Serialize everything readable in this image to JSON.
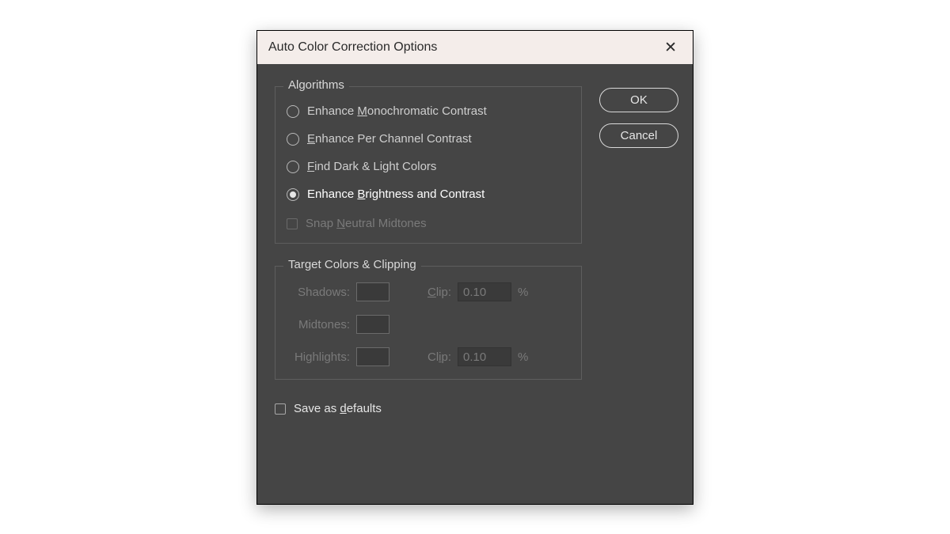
{
  "dialog": {
    "title": "Auto Color Correction Options"
  },
  "buttons": {
    "ok": "OK",
    "cancel": "Cancel"
  },
  "algorithms": {
    "legend": "Algorithms",
    "mono_pre": "Enhance ",
    "mono_u": "M",
    "mono_post": "onochromatic Contrast",
    "perch_u": "E",
    "perch_post": "nhance Per Channel Contrast",
    "find_u": "F",
    "find_post": "ind Dark & Light Colors",
    "bright_pre": "Enhance ",
    "bright_u": "B",
    "bright_post": "rightness and Contrast",
    "snap_pre": "Snap ",
    "snap_u": "N",
    "snap_post": "eutral Midtones"
  },
  "target": {
    "legend": "Target Colors & Clipping",
    "shadows": "Shadows:",
    "midtones": "Midtones:",
    "highlights": "Highlights:",
    "clip_pre": "",
    "clip_u": "C",
    "clip_post": "lip:",
    "clip2_pre": "Cl",
    "clip2_u": "i",
    "clip2_post": "p:",
    "shadows_clip_value": "0.10",
    "highlights_clip_value": "0.10",
    "pct": "%"
  },
  "save": {
    "pre": "Save as ",
    "u": "d",
    "post": "efaults"
  }
}
